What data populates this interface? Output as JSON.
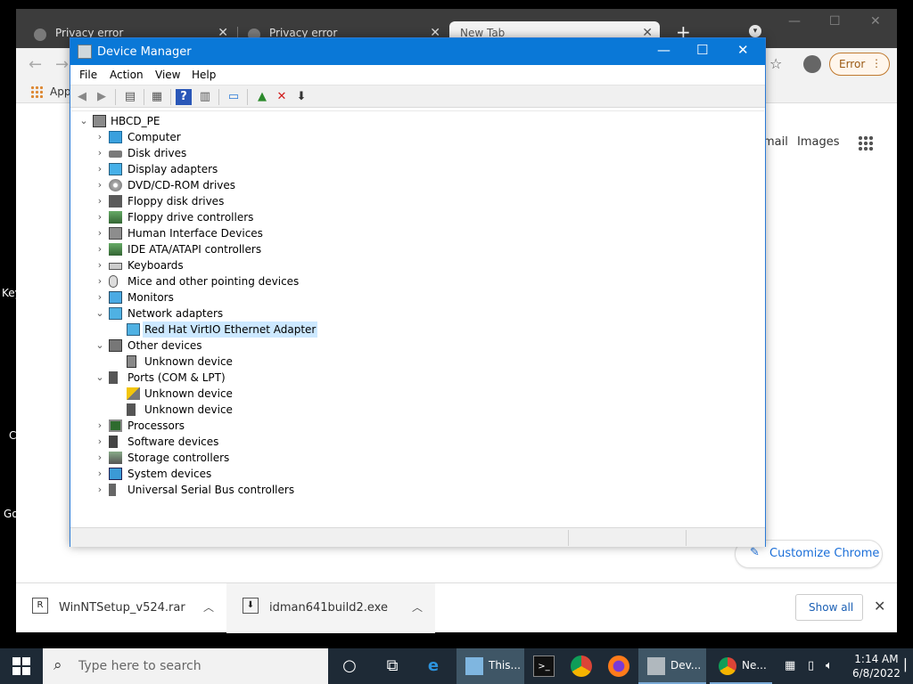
{
  "desktop": {
    "labels": [
      "Key",
      "C",
      "Go"
    ]
  },
  "browser": {
    "tabs": [
      {
        "title": "Privacy error"
      },
      {
        "title": "Privacy error"
      },
      {
        "title": "New Tab"
      }
    ],
    "error_chip": "Error",
    "bookmarks_apps": "Apps",
    "newtab": {
      "gmail": "mail",
      "images": "Images",
      "customize": "Customize Chrome"
    },
    "downloads": [
      {
        "name": "WinNTSetup_v524.rar"
      },
      {
        "name": "idman641build2.exe"
      }
    ],
    "show_all": "Show all"
  },
  "device_manager": {
    "title": "Device Manager",
    "menu": [
      "File",
      "Action",
      "View",
      "Help"
    ],
    "root": "HBCD_PE",
    "tree": [
      {
        "label": "Computer",
        "icon": "computer-icon",
        "expanded": false
      },
      {
        "label": "Disk drives",
        "icon": "disk-icon",
        "expanded": false
      },
      {
        "label": "Display adapters",
        "icon": "display-adapter-icon",
        "expanded": false
      },
      {
        "label": "DVD/CD-ROM drives",
        "icon": "dvd-icon",
        "expanded": false
      },
      {
        "label": "Floppy disk drives",
        "icon": "floppy-icon",
        "expanded": false
      },
      {
        "label": "Floppy drive controllers",
        "icon": "controller-icon",
        "expanded": false
      },
      {
        "label": "Human Interface Devices",
        "icon": "hid-icon",
        "expanded": false
      },
      {
        "label": "IDE ATA/ATAPI controllers",
        "icon": "controller-icon",
        "expanded": false
      },
      {
        "label": "Keyboards",
        "icon": "keyboard-icon",
        "expanded": false
      },
      {
        "label": "Mice and other pointing devices",
        "icon": "mouse-icon",
        "expanded": false
      },
      {
        "label": "Monitors",
        "icon": "monitor-icon",
        "expanded": false
      },
      {
        "label": "Network adapters",
        "icon": "network-icon",
        "expanded": true,
        "children": [
          {
            "label": "Red Hat VirtIO Ethernet Adapter",
            "icon": "network-icon",
            "selected": true
          }
        ]
      },
      {
        "label": "Other devices",
        "icon": "other-devices-icon",
        "expanded": true,
        "children": [
          {
            "label": "Unknown device",
            "icon": "unknown-device-icon"
          }
        ]
      },
      {
        "label": "Ports (COM & LPT)",
        "icon": "port-icon",
        "expanded": true,
        "children": [
          {
            "label": "Unknown device",
            "icon": "warning-device-icon"
          },
          {
            "label": "Unknown device",
            "icon": "port-icon"
          }
        ]
      },
      {
        "label": "Processors",
        "icon": "processor-icon",
        "expanded": false
      },
      {
        "label": "Software devices",
        "icon": "software-icon",
        "expanded": false
      },
      {
        "label": "Storage controllers",
        "icon": "storage-icon",
        "expanded": false
      },
      {
        "label": "System devices",
        "icon": "system-icon",
        "expanded": false
      },
      {
        "label": "Universal Serial Bus controllers",
        "icon": "usb-icon",
        "expanded": false
      }
    ]
  },
  "taskbar": {
    "search_placeholder": "Type here to search",
    "items": [
      {
        "label": "This..."
      },
      {
        "label": "Dev..."
      },
      {
        "label": "Ne..."
      }
    ],
    "time": "1:14 AM",
    "date": "6/8/2022"
  },
  "colors": {
    "title_bar": "#0a78d7",
    "selection": "#cce8ff",
    "taskbar": "#1e2a36"
  }
}
